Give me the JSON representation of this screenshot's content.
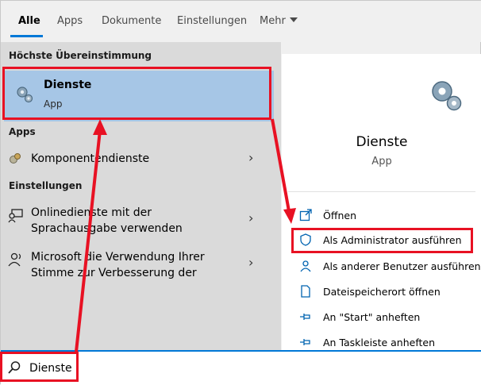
{
  "tabs": [
    {
      "label": "Alle",
      "active": true
    },
    {
      "label": "Apps"
    },
    {
      "label": "Dokumente"
    },
    {
      "label": "Einstellungen"
    },
    {
      "label": "Mehr"
    }
  ],
  "best_match": {
    "header": "Höchste Übereinstimmung",
    "title": "Dienste",
    "subtitle": "App",
    "icon": "gears-icon"
  },
  "apps_section": {
    "header": "Apps",
    "items": [
      {
        "label": "Komponentendienste",
        "icon": "component-services-icon"
      }
    ]
  },
  "settings_section": {
    "header": "Einstellungen",
    "items": [
      {
        "line1": "Onlinedienste mit der",
        "line2": "Sprachausgabe verwenden",
        "icon": "speech-monitor-icon"
      },
      {
        "line1": "Microsoft die Verwendung Ihrer",
        "line2": "Stimme zur Verbesserung der",
        "icon": "speech-person-icon"
      }
    ]
  },
  "detail": {
    "title": "Dienste",
    "subtitle": "App",
    "actions": [
      {
        "label": "Öffnen",
        "icon": "open-icon"
      },
      {
        "label": "Als Administrator ausführen",
        "icon": "shield-icon"
      },
      {
        "label": "Als anderer Benutzer ausführen",
        "icon": "user-icon"
      },
      {
        "label": "Dateispeicherort öffnen",
        "icon": "file-icon"
      },
      {
        "label": "An \"Start\" anheften",
        "icon": "pin-icon"
      },
      {
        "label": "An Taskleiste anheften",
        "icon": "pin-icon"
      }
    ]
  },
  "search": {
    "value": "Dienste",
    "icon": "search-icon"
  },
  "colors": {
    "accent": "#0078d7",
    "highlight": "#a6c6e6",
    "annotation": "#e81123"
  }
}
